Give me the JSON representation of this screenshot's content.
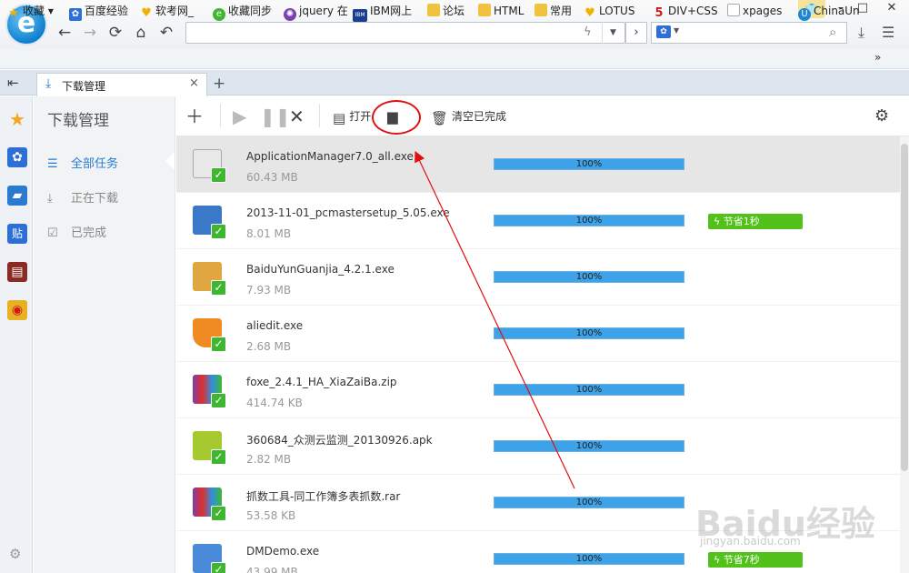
{
  "browser": {
    "logo": "e",
    "bookmarks": [
      {
        "label": "收藏",
        "icon": "star-icon"
      },
      {
        "label": "百度经验",
        "icon": "baidu-icon"
      },
      {
        "label": "软考网_",
        "icon": "heart-icon"
      },
      {
        "label": "收藏同步",
        "icon": "sync-icon"
      },
      {
        "label": "jquery 在",
        "icon": "jquery-icon"
      },
      {
        "label": "IBM网上",
        "icon": "ibm-icon"
      },
      {
        "label": "论坛",
        "icon": "folder-icon"
      },
      {
        "label": "HTML",
        "icon": "folder-icon"
      },
      {
        "label": "常用",
        "icon": "folder-icon"
      },
      {
        "label": "LOTUS",
        "icon": "heart-icon"
      },
      {
        "label": "DIV+CSS",
        "icon": "5-icon"
      },
      {
        "label": "xpages",
        "icon": "page-icon"
      },
      {
        "label": "ChinaUn",
        "icon": "u-icon"
      }
    ],
    "more": "»",
    "tab": {
      "title": "下载管理"
    }
  },
  "manager": {
    "title": "下载管理",
    "nav": [
      {
        "label": "全部任务",
        "active": true
      },
      {
        "label": "正在下载",
        "active": false
      },
      {
        "label": "已完成",
        "active": false
      }
    ],
    "toolbar": {
      "open": "打开",
      "clear": "清空已完成"
    }
  },
  "downloads": [
    {
      "name": "ApplicationManager7.0_all.exe",
      "size": "60.43 MB",
      "progress": "100%",
      "icon": "adobe-installer-icon",
      "badge": null,
      "selected": true
    },
    {
      "name": "2013-11-01_pcmastersetup_5.05.exe",
      "size": "8.01 MB",
      "progress": "100%",
      "icon": "package-icon",
      "badge": "节省1秒",
      "selected": false
    },
    {
      "name": "BaiduYunGuanjia_4.2.1.exe",
      "size": "7.93 MB",
      "progress": "100%",
      "icon": "box-icon",
      "badge": null,
      "selected": false
    },
    {
      "name": "aliedit.exe",
      "size": "2.68 MB",
      "progress": "100%",
      "icon": "shield-icon",
      "badge": null,
      "selected": false
    },
    {
      "name": "foxe_2.4.1_HA_XiaZaiBa.zip",
      "size": "414.74 KB",
      "progress": "100%",
      "icon": "archive-icon",
      "badge": null,
      "selected": false
    },
    {
      "name": "360684_众测云监测_20130926.apk",
      "size": "2.82 MB",
      "progress": "100%",
      "icon": "apk-icon",
      "badge": null,
      "selected": false
    },
    {
      "name": "抓数工具-同工作簿多表抓数.rar",
      "size": "53.58 KB",
      "progress": "100%",
      "icon": "archive-icon",
      "badge": null,
      "selected": false
    },
    {
      "name": "DMDemo.exe",
      "size": "43.99 MB",
      "progress": "100%",
      "icon": "installer-icon",
      "badge": "节省7秒",
      "selected": false
    }
  ],
  "watermark": {
    "text": "Baidu经验",
    "url": "jingyan.baidu.com"
  },
  "colors": {
    "accent": "#2a7bd0",
    "progress": "#3ea2e8",
    "badge": "#52c21a",
    "check": "#3fb630",
    "callout": "#e01010"
  }
}
